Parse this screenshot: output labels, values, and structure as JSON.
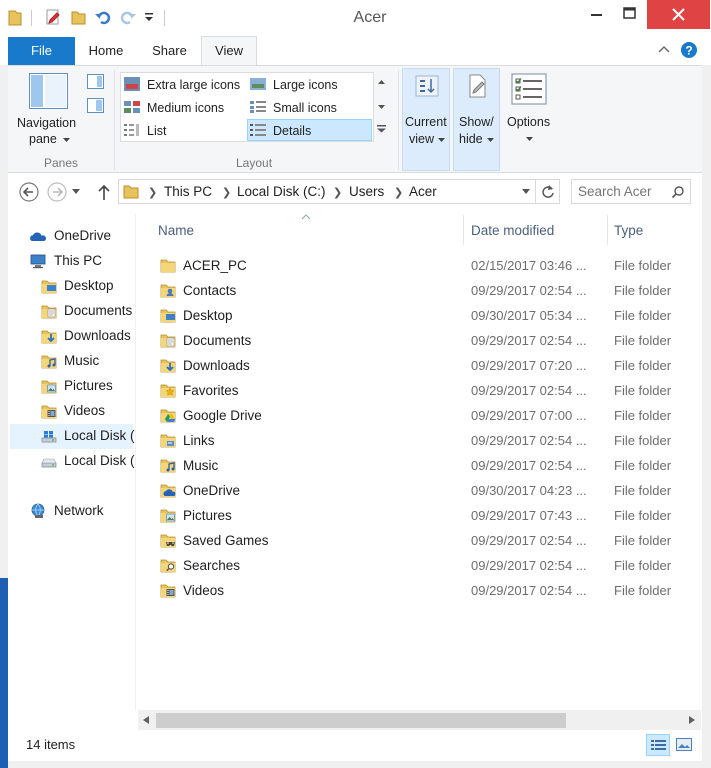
{
  "window": {
    "title": "Acer",
    "quick_access": [
      "properties-icon",
      "new-folder-icon",
      "undo-icon",
      "redo-icon",
      "customize-qat-icon"
    ],
    "controls": [
      "minimize-icon",
      "maximize-icon",
      "close-icon"
    ],
    "accent": "#1979ca",
    "close_color": "#e04343"
  },
  "ribbon": {
    "tabs": [
      "File",
      "Home",
      "Share",
      "View"
    ],
    "active_tab": "View",
    "panes_group": {
      "navigation_pane_line1": "Navigation",
      "navigation_pane_line2": "pane",
      "group_name": "Panes"
    },
    "layout_group": {
      "options": [
        "Extra large icons",
        "Large icons",
        "Medium icons",
        "Small icons",
        "List",
        "Details"
      ],
      "selected": "Details",
      "group_name": "Layout"
    },
    "current_view": {
      "line1": "Current",
      "line2": "view"
    },
    "show_hide": {
      "line1": "Show/",
      "line2": "hide"
    },
    "options": {
      "label": "Options"
    }
  },
  "address": {
    "breadcrumb": [
      "This PC",
      "Local Disk (C:)",
      "Users",
      "Acer"
    ],
    "search_placeholder": "Search Acer"
  },
  "nav_pane": {
    "items": [
      {
        "label": "OneDrive",
        "icon": "onedrive-icon"
      },
      {
        "label": "This PC",
        "icon": "computer-icon"
      },
      {
        "label": "Desktop",
        "icon": "desktop-folder-icon"
      },
      {
        "label": "Documents",
        "icon": "documents-folder-icon"
      },
      {
        "label": "Downloads",
        "icon": "downloads-folder-icon"
      },
      {
        "label": "Music",
        "icon": "music-folder-icon"
      },
      {
        "label": "Pictures",
        "icon": "pictures-folder-icon"
      },
      {
        "label": "Videos",
        "icon": "videos-folder-icon"
      },
      {
        "label": "Local Disk (",
        "icon": "system-drive-icon"
      },
      {
        "label": "Local Disk (",
        "icon": "drive-icon"
      },
      {
        "label": "Network",
        "icon": "network-icon"
      }
    ],
    "selected_index": 8
  },
  "file_list": {
    "columns": [
      "Name",
      "Date modified",
      "Type"
    ],
    "rows": [
      {
        "name": "ACER_PC",
        "date": "02/15/2017 03:46 ...",
        "type": "File folder",
        "icon": "folder-icon"
      },
      {
        "name": "Contacts",
        "date": "09/29/2017 02:54 ...",
        "type": "File folder",
        "icon": "contacts-folder-icon"
      },
      {
        "name": "Desktop",
        "date": "09/30/2017 05:34 ...",
        "type": "File folder",
        "icon": "desktop-folder-icon"
      },
      {
        "name": "Documents",
        "date": "09/29/2017 02:54 ...",
        "type": "File folder",
        "icon": "documents-folder-icon"
      },
      {
        "name": "Downloads",
        "date": "09/29/2017 07:20 ...",
        "type": "File folder",
        "icon": "downloads-folder-icon"
      },
      {
        "name": "Favorites",
        "date": "09/29/2017 02:54 ...",
        "type": "File folder",
        "icon": "favorites-folder-icon"
      },
      {
        "name": "Google Drive",
        "date": "09/29/2017 07:00 ...",
        "type": "File folder",
        "icon": "google-drive-folder-icon"
      },
      {
        "name": "Links",
        "date": "09/29/2017 02:54 ...",
        "type": "File folder",
        "icon": "links-folder-icon"
      },
      {
        "name": "Music",
        "date": "09/29/2017 02:54 ...",
        "type": "File folder",
        "icon": "music-folder-icon"
      },
      {
        "name": "OneDrive",
        "date": "09/30/2017 04:23 ...",
        "type": "File folder",
        "icon": "onedrive-folder-icon"
      },
      {
        "name": "Pictures",
        "date": "09/29/2017 07:43 ...",
        "type": "File folder",
        "icon": "pictures-folder-icon"
      },
      {
        "name": "Saved Games",
        "date": "09/29/2017 02:54 ...",
        "type": "File folder",
        "icon": "saved-games-folder-icon"
      },
      {
        "name": "Searches",
        "date": "09/29/2017 02:54 ...",
        "type": "File folder",
        "icon": "searches-folder-icon"
      },
      {
        "name": "Videos",
        "date": "09/29/2017 02:54 ...",
        "type": "File folder",
        "icon": "videos-folder-icon"
      }
    ]
  },
  "status": {
    "item_count": "14 items",
    "view_buttons": [
      "details-view-icon",
      "large-icons-view-icon"
    ]
  }
}
